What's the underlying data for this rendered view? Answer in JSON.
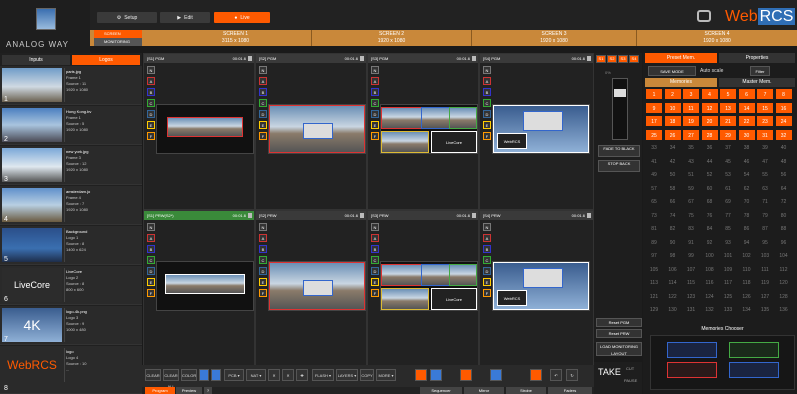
{
  "app": {
    "brand": "ANALOG WAY",
    "product_prefix": "Web",
    "product_suffix": "RCS"
  },
  "modes": [
    {
      "label": "Setup",
      "icon": "gear-icon"
    },
    {
      "label": "Edit",
      "icon": "play-icon"
    },
    {
      "label": "Live",
      "icon": "live-icon"
    }
  ],
  "screen_tags": [
    {
      "label": "SCREEN"
    },
    {
      "label": "MONITORING"
    }
  ],
  "screens": [
    {
      "name": "SCREEN 1",
      "res": "3115 x 1080"
    },
    {
      "name": "SCREEN 2",
      "res": "1920 x 1080"
    },
    {
      "name": "SCREEN 3",
      "res": "1920 x 1080"
    },
    {
      "name": "SCREEN 4",
      "res": "1920 x 1080"
    }
  ],
  "left_tabs": [
    "Inputs",
    "Logos"
  ],
  "sources": [
    {
      "num": "1",
      "name": "paris.jpg",
      "l1": "Frame 1",
      "l2": "Source : 11",
      "l3": "1920 x 1080"
    },
    {
      "num": "2",
      "name": "Hong Kong.bv",
      "l1": "Frame 1",
      "l2": "Source : 5",
      "l3": "1920 x 1080"
    },
    {
      "num": "3",
      "name": "new york.jpg",
      "l1": "Frame 3",
      "l2": "Source : 12",
      "l3": "1920 x 1080"
    },
    {
      "num": "4",
      "name": "amsterdam.jo",
      "l1": "Frame 4",
      "l2": "Source : 7",
      "l3": "1920 x 1080"
    },
    {
      "num": "5",
      "name": "Background",
      "l1": "Logo 1",
      "l2": "Source : 8",
      "l3": "1400 x 624"
    },
    {
      "num": "6",
      "name": "LiveCore",
      "l1": "Logo 2",
      "l2": "Source : 8",
      "l3": "800 x 600"
    },
    {
      "num": "7",
      "name": "logo-4k.png",
      "l1": "Logo 3",
      "l2": "Source : 9",
      "l3": "1000 x 480"
    },
    {
      "num": "8",
      "name": "logo",
      "l1": "Logo 4",
      "l2": "Source : 10",
      "l3": "..."
    }
  ],
  "panes_top": [
    {
      "title": "[S1] PGM",
      "tc": "00:01.6"
    },
    {
      "title": "[S2] PGM",
      "tc": "00:01.6"
    },
    {
      "title": "[S3] PGM",
      "tc": "00:01.6"
    },
    {
      "title": "[S4] PGM",
      "tc": "00:01.6"
    }
  ],
  "panes_bottom": [
    {
      "title": "[S1] PRW(S2*)",
      "tc": "00:01.6"
    },
    {
      "title": "[S2] PRW",
      "tc": "00:01.6"
    },
    {
      "title": "[S3] PRW",
      "tc": "00:01.6"
    },
    {
      "title": "[S4] PRW",
      "tc": "00:01.6"
    }
  ],
  "layers": [
    "N",
    "A",
    "B",
    "C",
    "D",
    "E",
    "F"
  ],
  "screen_select": [
    "S1",
    "S2",
    "S3",
    "S4"
  ],
  "middle": {
    "fader": "0%",
    "fade_btn": "FADE TO BLACK",
    "stop_btn": "STOP BACK"
  },
  "actions": {
    "reset_pgm": "Reset PGM",
    "reset_prw": "Reset PRW",
    "load": "LOAD MONITORING LAYOUT",
    "take": "TAKE",
    "cut": "CUT",
    "pause": "PAUSE"
  },
  "right": {
    "tabs": [
      "Preset Mem.",
      "Properties"
    ],
    "save": "SAVE MODE",
    "autoscale": "Auto scale",
    "filter": "Filter",
    "subtabs": [
      "Memories",
      "Master Mem."
    ],
    "memories": [
      "1",
      "2",
      "3",
      "4",
      "5",
      "6",
      "7",
      "8",
      "9",
      "10",
      "11",
      "12",
      "13",
      "14",
      "15",
      "16",
      "17",
      "18",
      "19",
      "20",
      "21",
      "22",
      "23",
      "24",
      "25",
      "26",
      "27",
      "28",
      "29",
      "30",
      "31",
      "32",
      "33",
      "34",
      "35",
      "36",
      "37",
      "38",
      "39",
      "40",
      "41",
      "42",
      "43",
      "44",
      "45",
      "46",
      "47",
      "48",
      "49",
      "50",
      "51",
      "52",
      "53",
      "54",
      "55",
      "56",
      "57",
      "58",
      "59",
      "60",
      "61",
      "62",
      "63",
      "64",
      "65",
      "66",
      "67",
      "68",
      "69",
      "70",
      "71",
      "72",
      "73",
      "74",
      "75",
      "76",
      "77",
      "78",
      "79",
      "80",
      "81",
      "82",
      "83",
      "84",
      "85",
      "86",
      "87",
      "88",
      "89",
      "90",
      "91",
      "92",
      "93",
      "94",
      "95",
      "96",
      "97",
      "98",
      "99",
      "100",
      "101",
      "102",
      "103",
      "104",
      "105",
      "106",
      "107",
      "108",
      "109",
      "110",
      "111",
      "112",
      "113",
      "114",
      "115",
      "116",
      "117",
      "118",
      "119",
      "120",
      "121",
      "122",
      "123",
      "124",
      "125",
      "126",
      "127",
      "128",
      "129",
      "130",
      "131",
      "132",
      "133",
      "134",
      "135",
      "136"
    ],
    "chooser": "Memories Chooser"
  },
  "bottom_tabs": [
    "Program",
    "Preview",
    "?"
  ],
  "bottom_right_tabs": [
    "Sequencer",
    "Mirror",
    "Strobe",
    "Faders"
  ],
  "tools": [
    "CLEAR",
    "CLEAR ALL",
    "COLOR",
    "PCB ▾",
    "NAT ▾",
    "FLASH ▾",
    "LAYERS ▾",
    "COPY",
    "MORE ▾"
  ],
  "colors": {
    "accent": "#ff5a00",
    "brand_blue": "#2f6eb5",
    "screen_bar": "#c9883a"
  }
}
